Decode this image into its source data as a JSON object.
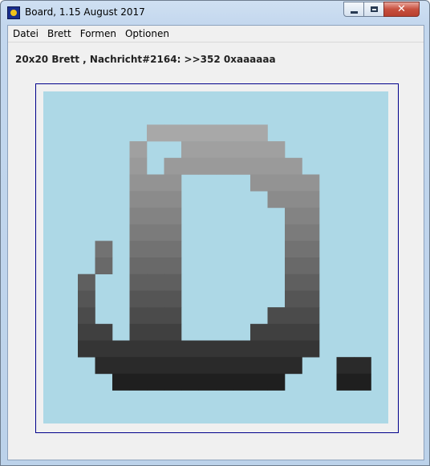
{
  "window": {
    "title": "Board, 1.15 August 2017"
  },
  "menu": [
    "Datei",
    "Brett",
    "Formen",
    "Optionen"
  ],
  "status_text": "20x20 Brett , Nachricht#2164: >>352 0xaaaaaa",
  "board": {
    "cols": 20,
    "rows": 20,
    "background": "#add8e6",
    "cells": [
      {
        "row": 2,
        "cols": [
          6,
          7,
          8,
          9,
          10,
          11,
          12
        ],
        "color": "#a8a8a8"
      },
      {
        "row": 3,
        "cols": [
          5,
          8,
          9,
          10,
          11,
          12,
          13
        ],
        "color": "#a0a0a0"
      },
      {
        "row": 4,
        "cols": [
          5,
          7,
          8,
          9,
          10,
          11,
          12,
          13,
          14
        ],
        "color": "#9a9a9a"
      },
      {
        "row": 5,
        "cols": [
          5,
          6,
          7,
          12,
          13,
          14,
          15
        ],
        "color": "#939393"
      },
      {
        "row": 6,
        "cols": [
          5,
          6,
          7,
          13,
          14,
          15
        ],
        "color": "#8b8b8b"
      },
      {
        "row": 7,
        "cols": [
          5,
          6,
          7,
          14,
          15
        ],
        "color": "#838383"
      },
      {
        "row": 8,
        "cols": [
          5,
          6,
          7,
          14,
          15
        ],
        "color": "#7b7b7b"
      },
      {
        "row": 9,
        "cols": [
          3,
          5,
          6,
          7,
          14,
          15
        ],
        "color": "#727272"
      },
      {
        "row": 10,
        "cols": [
          3,
          5,
          6,
          7,
          14,
          15
        ],
        "color": "#696969"
      },
      {
        "row": 11,
        "cols": [
          2,
          5,
          6,
          7,
          14,
          15
        ],
        "color": "#5f5f5f"
      },
      {
        "row": 12,
        "cols": [
          2,
          5,
          6,
          7,
          14,
          15
        ],
        "color": "#555555"
      },
      {
        "row": 13,
        "cols": [
          2,
          5,
          6,
          7,
          13,
          14,
          15
        ],
        "color": "#4b4b4b"
      },
      {
        "row": 14,
        "cols": [
          2,
          3,
          5,
          6,
          7,
          12,
          13,
          14,
          15
        ],
        "color": "#404040"
      },
      {
        "row": 15,
        "cols": [
          2,
          3,
          4,
          5,
          6,
          7,
          8,
          9,
          10,
          11,
          12,
          13,
          14,
          15
        ],
        "color": "#353535"
      },
      {
        "row": 16,
        "cols": [
          3,
          4,
          5,
          6,
          7,
          8,
          9,
          10,
          11,
          12,
          13,
          14,
          17,
          18
        ],
        "color": "#2a2a2a"
      },
      {
        "row": 17,
        "cols": [
          4,
          5,
          6,
          7,
          8,
          9,
          10,
          11,
          12,
          13,
          17,
          18
        ],
        "color": "#1f1f1f"
      }
    ]
  },
  "colors": {
    "frame_border": "#00008b",
    "client_bg": "#f0f0f0"
  }
}
